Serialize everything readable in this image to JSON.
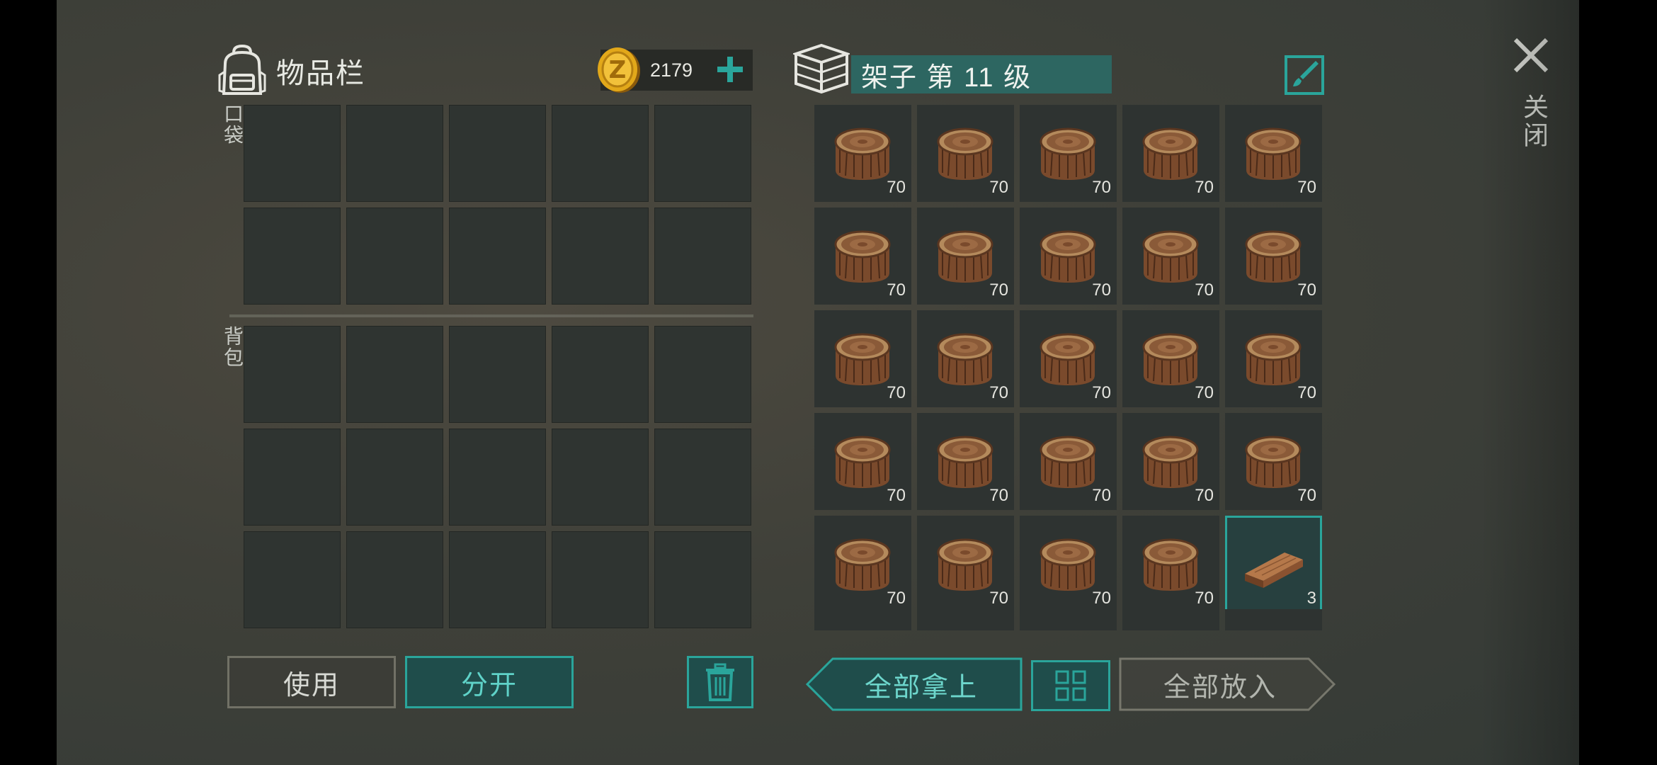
{
  "inventory": {
    "title": "物品栏",
    "coins": "2179",
    "pocket_label": "口袋",
    "backpack_label": "背包",
    "pocket_slots": 10,
    "backpack_slots": 15
  },
  "storage": {
    "title": "架子 第 11 级",
    "slots": [
      {
        "item": "log",
        "qty": "70"
      },
      {
        "item": "log",
        "qty": "70"
      },
      {
        "item": "log",
        "qty": "70"
      },
      {
        "item": "log",
        "qty": "70"
      },
      {
        "item": "log",
        "qty": "70"
      },
      {
        "item": "log",
        "qty": "70"
      },
      {
        "item": "log",
        "qty": "70"
      },
      {
        "item": "log",
        "qty": "70"
      },
      {
        "item": "log",
        "qty": "70"
      },
      {
        "item": "log",
        "qty": "70"
      },
      {
        "item": "log",
        "qty": "70"
      },
      {
        "item": "log",
        "qty": "70"
      },
      {
        "item": "log",
        "qty": "70"
      },
      {
        "item": "log",
        "qty": "70"
      },
      {
        "item": "log",
        "qty": "70"
      },
      {
        "item": "log",
        "qty": "70"
      },
      {
        "item": "log",
        "qty": "70"
      },
      {
        "item": "log",
        "qty": "70"
      },
      {
        "item": "log",
        "qty": "70"
      },
      {
        "item": "log",
        "qty": "70"
      },
      {
        "item": "log",
        "qty": "70"
      },
      {
        "item": "log",
        "qty": "70"
      },
      {
        "item": "log",
        "qty": "70"
      },
      {
        "item": "log",
        "qty": "70"
      },
      {
        "item": "plank",
        "qty": "3",
        "selected": true
      }
    ]
  },
  "close_label": "关闭",
  "buttons": {
    "use": "使用",
    "split": "分开",
    "take_all": "全部拿上",
    "put_all": "全部放入"
  },
  "icons": {
    "backpack": "backpack-icon",
    "coin": "coin-icon",
    "plus": "plus-icon",
    "storage": "shelf-icon",
    "rename": "edit-brush-icon",
    "close": "close-icon",
    "trash": "trash-icon",
    "sort": "sort-grid-icon",
    "log": "wood-log-icon",
    "plank": "wood-plank-icon"
  },
  "colors": {
    "accent": "#2aa59b",
    "title_bg": "#2d6661",
    "coin": "#e2a81a"
  }
}
